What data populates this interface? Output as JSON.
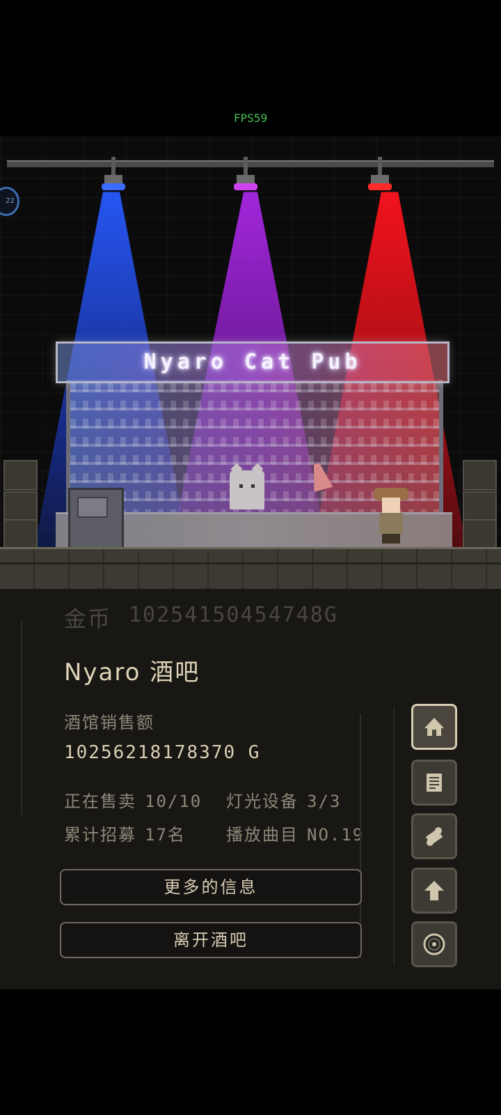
{
  "fps": "FPS59",
  "scene": {
    "sign_text": "Nyaro Cat Pub",
    "badge_text": "22",
    "light_colors": [
      "#2a5cff",
      "#b02de6",
      "#ff1a24"
    ]
  },
  "panel": {
    "gold_label": "金币",
    "gold_value": "102541504547​48G",
    "bar_name": "Nyaro 酒吧",
    "sales_label": "酒馆销售额",
    "sales_value": "10256218178370 G",
    "stats": {
      "selling_label": "正在售卖",
      "selling_value": "10/10",
      "lighting_label": "灯光设备",
      "lighting_value": "3/3",
      "recruited_label": "累计招募",
      "recruited_value": "17名",
      "track_label": "播放曲目",
      "track_value": "NO.19"
    },
    "more_info_button": "更多的信息",
    "leave_button": "离开酒吧"
  },
  "side_buttons": [
    {
      "name": "home-icon",
      "active": true
    },
    {
      "name": "document-icon",
      "active": false
    },
    {
      "name": "scroll-icon",
      "active": false
    },
    {
      "name": "arrow-up-icon",
      "active": false
    },
    {
      "name": "record-icon",
      "active": false
    }
  ]
}
